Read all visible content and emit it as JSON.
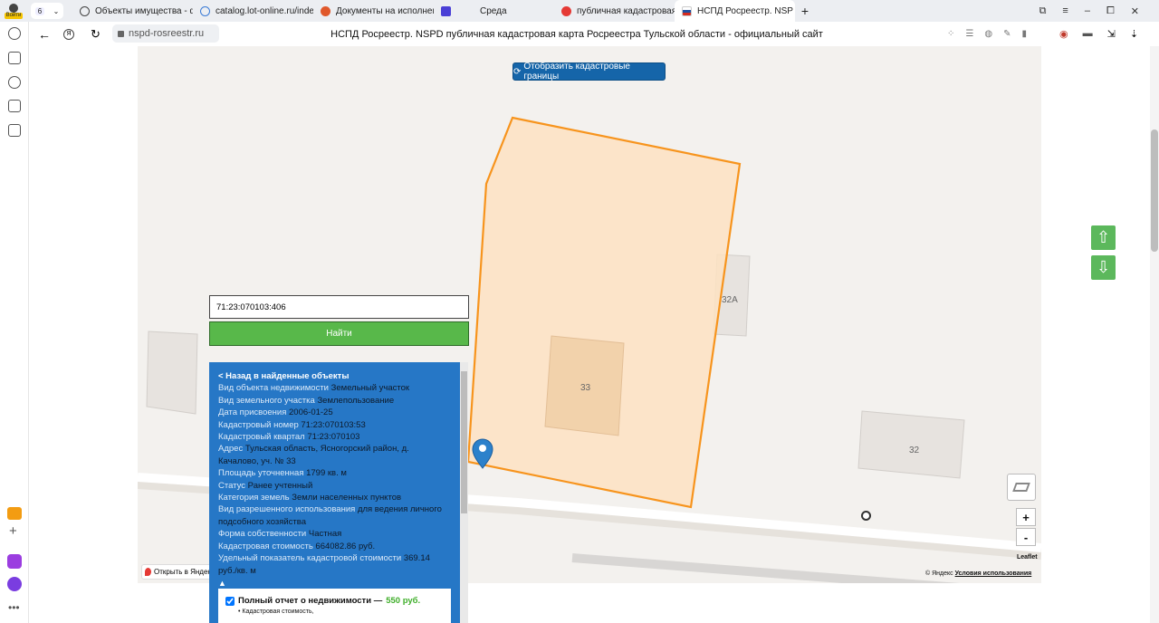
{
  "browser": {
    "profile_label": "Войти",
    "tab_count": "6",
    "tabs": [
      {
        "title": "Объекты имущества - ф",
        "color": "#555"
      },
      {
        "title": "catalog.lot-online.ru/inde",
        "color": "#3b7bd6"
      },
      {
        "title": "Документы на исполнен",
        "color": "#e0582b"
      },
      {
        "title": "Среда",
        "color": "#4a3fd6"
      },
      {
        "title": "публичная кадастровая",
        "color": "#e53935"
      },
      {
        "title": "НСПД Росреестр. NSP",
        "color": "#1e4fa0"
      }
    ],
    "address": "nspd-rosreestr.ru",
    "page_title": "НСПД Росреестр. NSPD публичная кадастровая карта Росреестра Тульской области - официальный сайт"
  },
  "map": {
    "show_borders_button": "Отобразить кадастровые границы",
    "building_labels": [
      "32А",
      "33",
      "32"
    ],
    "open_in_yandex": "Открыть в Яндекс",
    "attribution_prefix": "© Яндекс",
    "attribution_link": "Условия использования",
    "leaflet": "Leaflet",
    "zoom_in": "+",
    "zoom_out": "-",
    "arrow_up": "⇧",
    "arrow_down": "⇩",
    "parcel_fill": "#fde2c2",
    "parcel_stroke": "#f7941d"
  },
  "search": {
    "value": "71:23:070103:406",
    "button": "Найти"
  },
  "info": {
    "back": "< Назад в найденные объекты",
    "rows": [
      {
        "k": "Вид объекта недвижимости",
        "v": "Земельный участок"
      },
      {
        "k": "Вид земельного участка",
        "v": "Землепользование"
      },
      {
        "k": "Дата присвоения",
        "v": "2006-01-25"
      },
      {
        "k": "Кадастровый номер",
        "v": "71:23:070103:53"
      },
      {
        "k": "Кадастровый квартал",
        "v": "71:23:070103"
      },
      {
        "k": "Адрес",
        "v": "Тульская область, Ясногорский район, д. Качалово, уч. № 33"
      },
      {
        "k": "Площадь уточненная",
        "v": "1799 кв. м"
      },
      {
        "k": "Статус",
        "v": "Ранее учтенный"
      },
      {
        "k": "Категория земель",
        "v": "Земли населенных пунктов"
      },
      {
        "k": "Вид разрешенного использования",
        "v": "для ведения личного подсобного хозяйства"
      },
      {
        "k": "Форма собственности",
        "v": "Частная"
      },
      {
        "k": "Кадастровая стоимость",
        "v": "664082.86 руб."
      },
      {
        "k": "Удельный показатель кадастровой стоимости",
        "v": "369.14 руб./кв. м"
      }
    ],
    "toggle": "▲",
    "report_title": "Полный отчет о недвижимости —",
    "report_price": "550 руб.",
    "report_item": "Кадастровая стоимость,"
  }
}
